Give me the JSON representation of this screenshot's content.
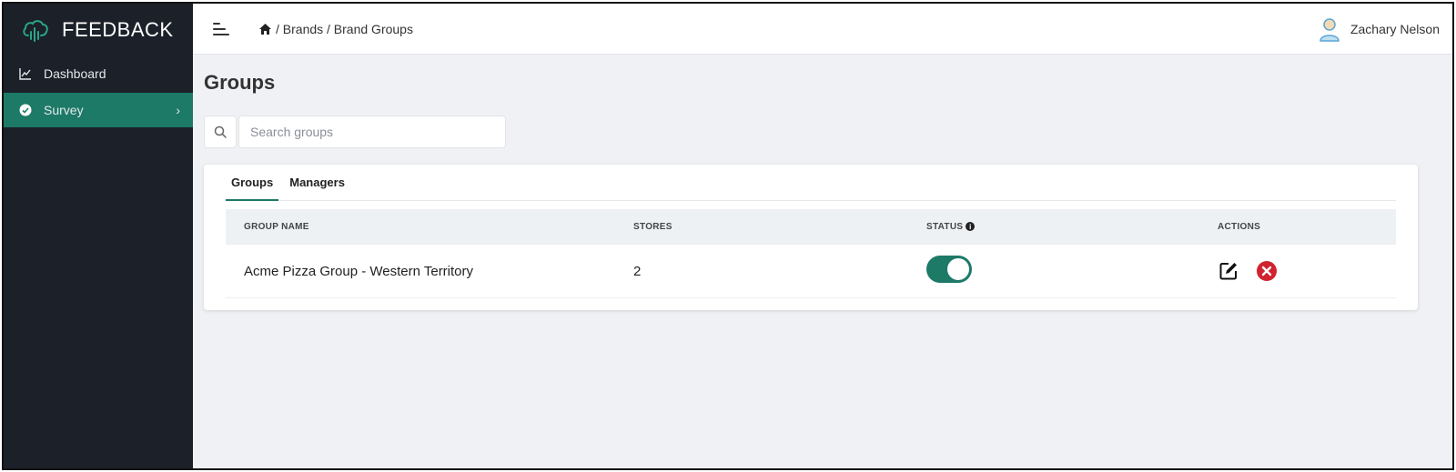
{
  "app": {
    "brand_name": "FEEDBACK"
  },
  "sidebar": {
    "items": [
      {
        "label": "Dashboard",
        "icon": "chart-line-icon",
        "active": false
      },
      {
        "label": "Survey",
        "icon": "check-circle-icon",
        "active": true,
        "chevron": "›"
      }
    ]
  },
  "topbar": {
    "breadcrumb": [
      " / Brands / Brand Groups"
    ],
    "user_name": "Zachary Nelson"
  },
  "main": {
    "page_title": "Groups",
    "search": {
      "placeholder": "Search groups",
      "value": ""
    },
    "tabs": [
      {
        "label": "Groups",
        "active": true
      },
      {
        "label": "Managers",
        "active": false
      }
    ],
    "table": {
      "headers": {
        "group_name": "GROUP NAME",
        "stores": "STORES",
        "status": "STATUS",
        "actions": "ACTIONS"
      },
      "rows": [
        {
          "group_name": "Acme Pizza Group - Western Territory",
          "stores": "2",
          "status_on": true
        }
      ]
    }
  },
  "colors": {
    "accent": "#1c7a67",
    "sidebar_bg": "#1b2029",
    "danger": "#d0222f",
    "page_bg": "#f0f1f4"
  }
}
